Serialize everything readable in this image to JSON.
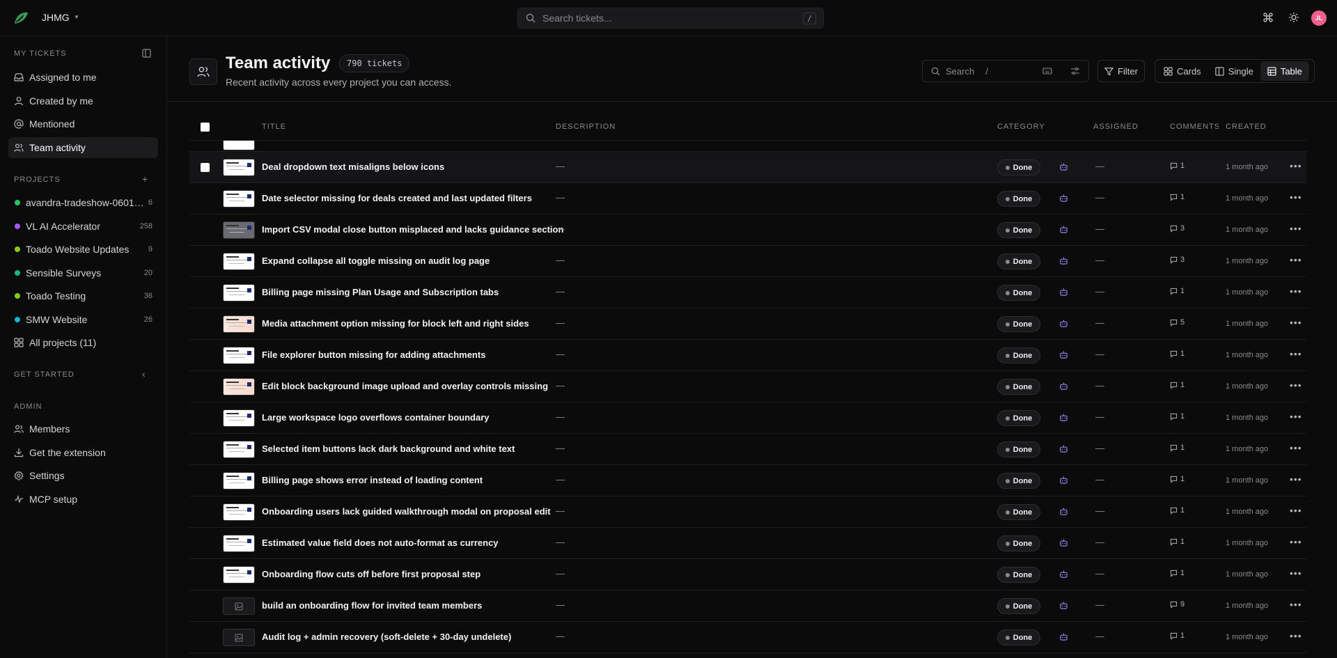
{
  "workspace": {
    "name": "JHMG"
  },
  "topbar": {
    "search_placeholder": "Search tickets...",
    "search_shortcut": "/",
    "avatar_initials": "JL"
  },
  "sidebar": {
    "my_tickets_label": "MY TICKETS",
    "my_tickets": [
      {
        "label": "Assigned to me",
        "icon": "inbox-icon"
      },
      {
        "label": "Created by me",
        "icon": "user-icon"
      },
      {
        "label": "Mentioned",
        "icon": "at-icon"
      },
      {
        "label": "Team activity",
        "icon": "users-icon",
        "active": true
      }
    ],
    "projects_label": "PROJECTS",
    "projects": [
      {
        "name": "avandra-tradeshow-0601…",
        "count": "6",
        "color": "#22c55e"
      },
      {
        "name": "VL AI Accelerator",
        "count": "258",
        "color": "#a855f7"
      },
      {
        "name": "Toado Website Updates",
        "count": "9",
        "color": "#84cc16"
      },
      {
        "name": "Sensible Surveys",
        "count": "20",
        "color": "#10b981"
      },
      {
        "name": "Toado Testing",
        "count": "36",
        "color": "#84cc16"
      },
      {
        "name": "SMW Website",
        "count": "26",
        "color": "#06b6d4"
      }
    ],
    "all_projects_label": "All projects (11)",
    "get_started_label": "GET STARTED",
    "admin_label": "ADMIN",
    "admin": [
      {
        "label": "Members",
        "icon": "users-icon"
      },
      {
        "label": "Get the extension",
        "icon": "download-icon"
      },
      {
        "label": "Settings",
        "icon": "gear-icon"
      },
      {
        "label": "MCP setup",
        "icon": "activity-icon"
      }
    ]
  },
  "header": {
    "title": "Team activity",
    "ticket_count": "790 tickets",
    "subtitle": "Recent activity across every project you can access.",
    "search_placeholder": "Search",
    "search_shortcut": "/",
    "filter_label": "Filter",
    "views": [
      {
        "label": "Cards",
        "icon": "grid-icon"
      },
      {
        "label": "Single",
        "icon": "columns-icon"
      },
      {
        "label": "Table",
        "icon": "table-icon",
        "active": true
      }
    ]
  },
  "table": {
    "columns": {
      "title": "TITLE",
      "description": "DESCRIPTION",
      "category": "CATEGORY",
      "assigned": "ASSIGNED",
      "comments": "COMMENTS",
      "created": "CREATED"
    },
    "rows": [
      {
        "title": "Deal dropdown text misaligns below icons",
        "description": "—",
        "status": "Done",
        "assigned": "—",
        "comments": "1",
        "created": "1 month ago",
        "thumb": "white"
      },
      {
        "title": "Date selector missing for deals created and last updated filters",
        "description": "—",
        "status": "Done",
        "assigned": "—",
        "comments": "1",
        "created": "1 month ago",
        "thumb": "white"
      },
      {
        "title": "Import CSV modal close button misplaced and lacks guidance section",
        "description": "—",
        "status": "Done",
        "assigned": "—",
        "comments": "3",
        "created": "1 month ago",
        "thumb": "grey"
      },
      {
        "title": "Expand collapse all toggle missing on audit log page",
        "description": "—",
        "status": "Done",
        "assigned": "—",
        "comments": "3",
        "created": "1 month ago",
        "thumb": "white"
      },
      {
        "title": "Billing page missing Plan Usage and Subscription tabs",
        "description": "—",
        "status": "Done",
        "assigned": "—",
        "comments": "1",
        "created": "1 month ago",
        "thumb": "white"
      },
      {
        "title": "Media attachment option missing for block left and right sides",
        "description": "—",
        "status": "Done",
        "assigned": "—",
        "comments": "5",
        "created": "1 month ago",
        "thumb": "peach"
      },
      {
        "title": "File explorer button missing for adding attachments",
        "description": "—",
        "status": "Done",
        "assigned": "—",
        "comments": "1",
        "created": "1 month ago",
        "thumb": "white"
      },
      {
        "title": "Edit block background image upload and overlay controls missing",
        "description": "—",
        "status": "Done",
        "assigned": "—",
        "comments": "1",
        "created": "1 month ago",
        "thumb": "peach"
      },
      {
        "title": "Large workspace logo overflows container boundary",
        "description": "—",
        "status": "Done",
        "assigned": "—",
        "comments": "1",
        "created": "1 month ago",
        "thumb": "white"
      },
      {
        "title": "Selected item buttons lack dark background and white text",
        "description": "—",
        "status": "Done",
        "assigned": "—",
        "comments": "1",
        "created": "1 month ago",
        "thumb": "white"
      },
      {
        "title": "Billing page shows error instead of loading content",
        "description": "—",
        "status": "Done",
        "assigned": "—",
        "comments": "1",
        "created": "1 month ago",
        "thumb": "white"
      },
      {
        "title": "Onboarding users lack guided walkthrough modal on proposal edit",
        "description": "—",
        "status": "Done",
        "assigned": "—",
        "comments": "1",
        "created": "1 month ago",
        "thumb": "white"
      },
      {
        "title": "Estimated value field does not auto-format as currency",
        "description": "—",
        "status": "Done",
        "assigned": "—",
        "comments": "1",
        "created": "1 month ago",
        "thumb": "white"
      },
      {
        "title": "Onboarding flow cuts off before first proposal step",
        "description": "—",
        "status": "Done",
        "assigned": "—",
        "comments": "1",
        "created": "1 month ago",
        "thumb": "white"
      },
      {
        "title": "build an onboarding flow for invited team members",
        "description": "—",
        "status": "Done",
        "assigned": "—",
        "comments": "9",
        "created": "1 month ago",
        "thumb": "placeholder"
      },
      {
        "title": "Audit log + admin recovery (soft-delete + 30-day undelete)",
        "description": "—",
        "status": "Done",
        "assigned": "—",
        "comments": "1",
        "created": "1 month ago",
        "thumb": "placeholder"
      }
    ]
  }
}
